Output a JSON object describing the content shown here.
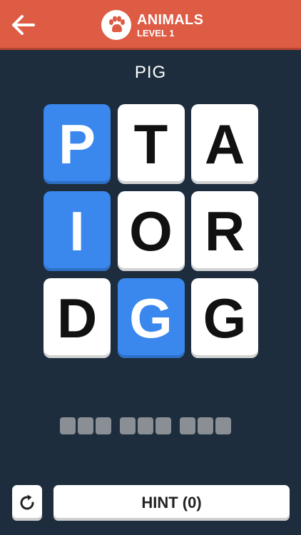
{
  "header": {
    "category_name": "ANIMALS",
    "level_label": "LEVEL 1",
    "back_icon": "arrow-left-icon",
    "category_icon": "paw-icon",
    "bar_color": "#de5b44"
  },
  "target_word": "PIG",
  "grid": {
    "rows": [
      [
        {
          "letter": "P",
          "selected": true
        },
        {
          "letter": "T",
          "selected": false
        },
        {
          "letter": "A",
          "selected": false
        }
      ],
      [
        {
          "letter": "I",
          "selected": true
        },
        {
          "letter": "O",
          "selected": false
        },
        {
          "letter": "R",
          "selected": false
        }
      ],
      [
        {
          "letter": "D",
          "selected": false
        },
        {
          "letter": "G",
          "selected": true
        },
        {
          "letter": "G",
          "selected": false
        }
      ]
    ],
    "selected_color": "#3a87ee",
    "tile_color": "#ffffff"
  },
  "answer_slots": [
    3,
    3,
    3
  ],
  "footer": {
    "refresh_icon": "refresh-icon",
    "hint_label": "HINT (0)"
  }
}
